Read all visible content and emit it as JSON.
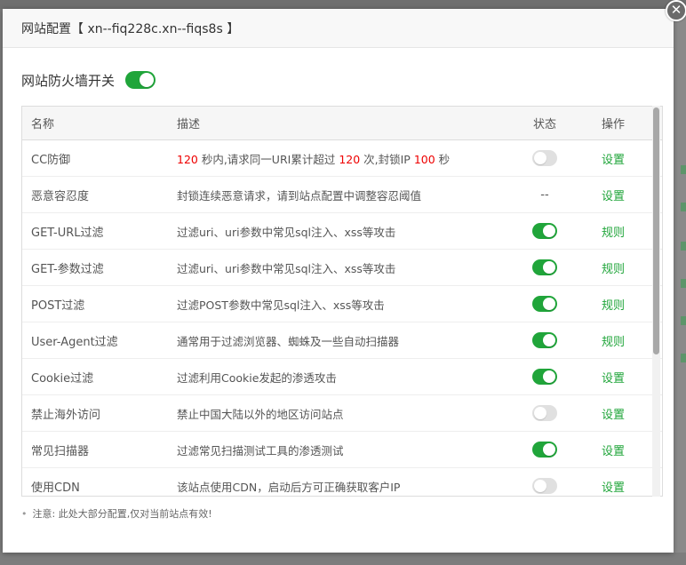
{
  "dialog": {
    "title": "网站配置【 xn--fiq228c.xn--fiqs8s 】",
    "close_icon": "close-icon"
  },
  "firewall": {
    "label": "网站防火墙开关",
    "enabled": true
  },
  "table": {
    "headers": {
      "name": "名称",
      "desc": "描述",
      "status": "状态",
      "action": "操作"
    },
    "cc_desc": {
      "seconds": "120",
      "part1": " 秒内,请求同一URI累计超过 ",
      "count": "120",
      "part2": " 次,封锁IP ",
      "ban": "100",
      "part3": " 秒"
    },
    "rows": [
      {
        "name": "CC防御",
        "desc": "",
        "status": "off",
        "action": "设置"
      },
      {
        "name": "恶意容忍度",
        "desc": "封锁连续恶意请求，请到站点配置中调整容忍阈值",
        "status_text": "--",
        "action": "设置"
      },
      {
        "name": "GET-URL过滤",
        "desc": "过滤uri、uri参数中常见sql注入、xss等攻击",
        "status": "on",
        "action": "规则"
      },
      {
        "name": "GET-参数过滤",
        "desc": "过滤uri、uri参数中常见sql注入、xss等攻击",
        "status": "on",
        "action": "规则"
      },
      {
        "name": "POST过滤",
        "desc": "过滤POST参数中常见sql注入、xss等攻击",
        "status": "on",
        "action": "规则"
      },
      {
        "name": "User-Agent过滤",
        "desc": "通常用于过滤浏览器、蜘蛛及一些自动扫描器",
        "status": "on",
        "action": "规则"
      },
      {
        "name": "Cookie过滤",
        "desc": "过滤利用Cookie发起的渗透攻击",
        "status": "on",
        "action": "设置"
      },
      {
        "name": "禁止海外访问",
        "desc": "禁止中国大陆以外的地区访问站点",
        "status": "off",
        "action": "设置"
      },
      {
        "name": "常见扫描器",
        "desc": "过滤常见扫描测试工具的渗透测试",
        "status": "on",
        "action": "设置"
      },
      {
        "name": "使用CDN",
        "desc": "该站点使用CDN，启动后方可正确获取客户IP",
        "status": "off",
        "action": "设置"
      }
    ]
  },
  "note": "注意: 此处大部分配置,仅对当前站点有效!",
  "colors": {
    "accent": "#20a53a",
    "highlight": "#ee0000"
  }
}
